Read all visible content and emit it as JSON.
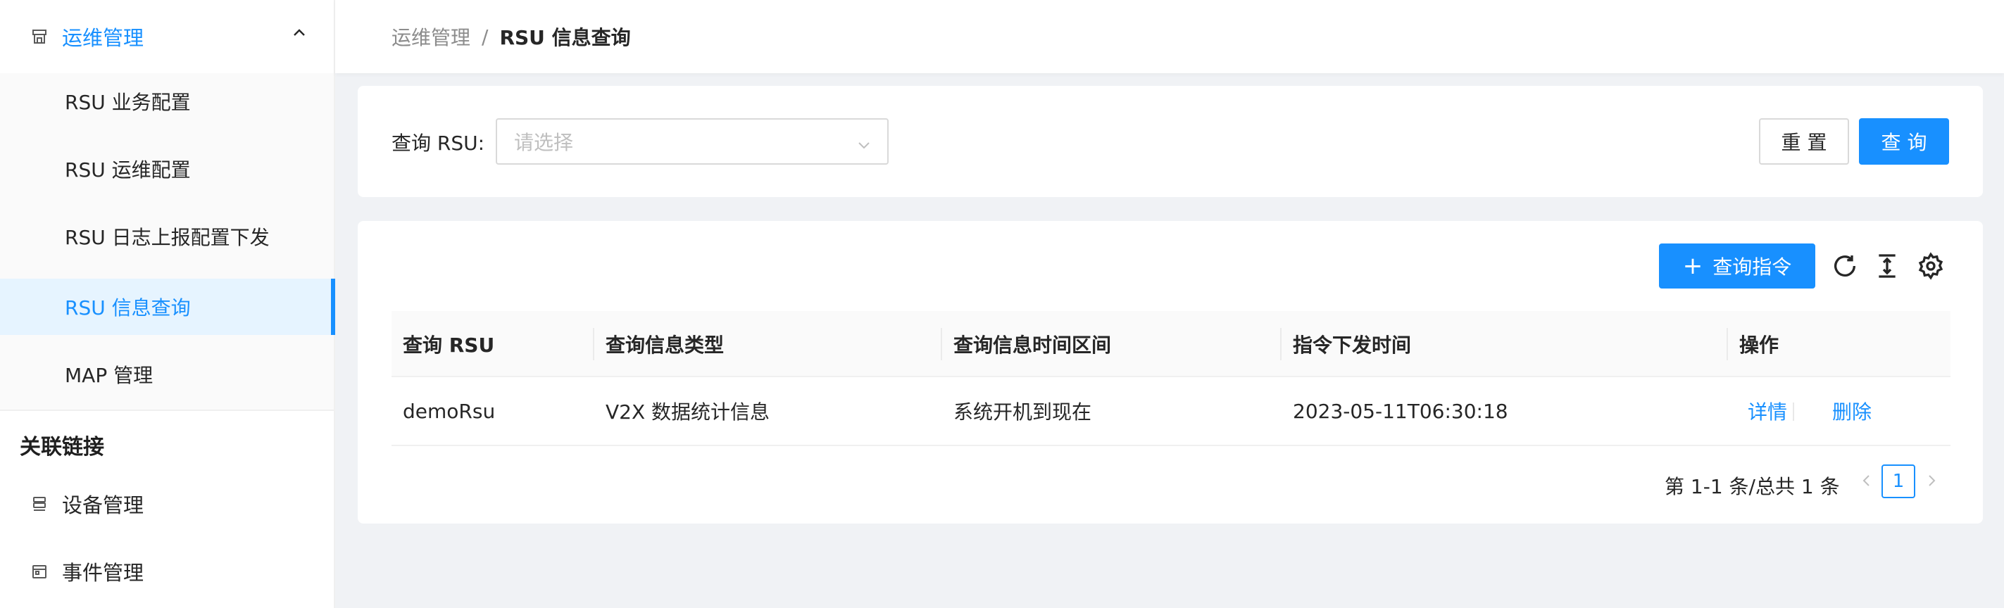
{
  "sidebar": {
    "parent": {
      "label": "运维管理",
      "icon": "shop-icon"
    },
    "submenu": [
      {
        "label": "RSU 业务配置"
      },
      {
        "label": "RSU 运维配置"
      },
      {
        "label": "RSU 日志上报配置下发"
      },
      {
        "label": "RSU 信息查询",
        "active": true
      },
      {
        "label": "MAP 管理"
      }
    ],
    "group_title": "关联链接",
    "links": [
      {
        "label": "设备管理",
        "icon": "database-icon"
      },
      {
        "label": "事件管理",
        "icon": "calendar-icon"
      }
    ]
  },
  "breadcrumb": {
    "parent": "运维管理",
    "separator": "/",
    "current": "RSU 信息查询"
  },
  "search": {
    "label": "查询 RSU",
    "colon": ":",
    "placeholder": "请选择",
    "reset_label": "重 置",
    "query_label": "查 询"
  },
  "toolbar": {
    "add_label": "查询指令",
    "icons": [
      "reload-icon",
      "column-height-icon",
      "setting-icon"
    ]
  },
  "table": {
    "columns": [
      "查询 RSU",
      "查询信息类型",
      "查询信息时间区间",
      "指令下发时间",
      "操作"
    ],
    "rows": [
      {
        "rsu": "demoRsu",
        "type": "V2X 数据统计信息",
        "range": "系统开机到现在",
        "time": "2023-05-11T06:30:18",
        "actions": [
          "详情",
          "删除"
        ]
      }
    ]
  },
  "pagination": {
    "total_text": "第 1-1 条/总共 1 条",
    "current_page": "1"
  },
  "colors": {
    "primary": "#1890ff",
    "active_bg": "#e6f4ff",
    "page_bg": "#f0f2f5"
  }
}
